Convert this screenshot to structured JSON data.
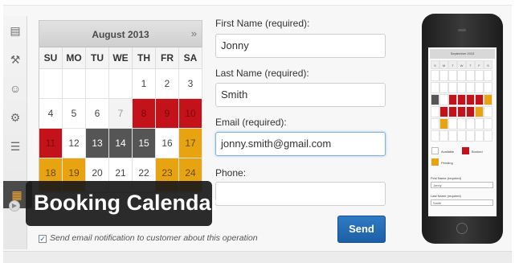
{
  "sidebar": {
    "icons": [
      {
        "name": "page-icon",
        "glyph": "▤"
      },
      {
        "name": "plugin-icon",
        "glyph": "⚒"
      },
      {
        "name": "users-icon",
        "glyph": "☺"
      },
      {
        "name": "tools-icon",
        "glyph": "⚙"
      },
      {
        "name": "settings-icon",
        "glyph": "☰"
      }
    ],
    "active_icon": {
      "name": "calendar-icon",
      "glyph": "▦"
    },
    "collapse_icon": {
      "name": "collapse-icon",
      "glyph": "▶"
    }
  },
  "calendar": {
    "month_title": "August 2013",
    "next_label": "»",
    "weekdays": [
      "SU",
      "MO",
      "TU",
      "WE",
      "TH",
      "FR",
      "SA"
    ],
    "weeks": [
      [
        {
          "d": "",
          "s": ""
        },
        {
          "d": "",
          "s": ""
        },
        {
          "d": "",
          "s": ""
        },
        {
          "d": "",
          "s": ""
        },
        {
          "d": "1",
          "s": ""
        },
        {
          "d": "2",
          "s": ""
        },
        {
          "d": "3",
          "s": ""
        }
      ],
      [
        {
          "d": "4",
          "s": ""
        },
        {
          "d": "5",
          "s": ""
        },
        {
          "d": "6",
          "s": ""
        },
        {
          "d": "7",
          "s": "past"
        },
        {
          "d": "8",
          "s": "red"
        },
        {
          "d": "9",
          "s": "red"
        },
        {
          "d": "10",
          "s": "red"
        }
      ],
      [
        {
          "d": "11",
          "s": "red"
        },
        {
          "d": "12",
          "s": ""
        },
        {
          "d": "13",
          "s": "dark"
        },
        {
          "d": "14",
          "s": "dark"
        },
        {
          "d": "15",
          "s": "dark"
        },
        {
          "d": "16",
          "s": ""
        },
        {
          "d": "17",
          "s": "orange"
        }
      ],
      [
        {
          "d": "18",
          "s": "orange"
        },
        {
          "d": "19",
          "s": "orange"
        },
        {
          "d": "20",
          "s": ""
        },
        {
          "d": "21",
          "s": ""
        },
        {
          "d": "22",
          "s": ""
        },
        {
          "d": "23",
          "s": "orange"
        },
        {
          "d": "24",
          "s": "orange"
        }
      ]
    ],
    "colors": {
      "booked": "#c4121b",
      "selected": "#555555",
      "pending": "#e8a310"
    }
  },
  "form": {
    "first_name_label": "First Name (required):",
    "first_name_value": "Jonny",
    "last_name_label": "Last Name (required):",
    "last_name_value": "Smith",
    "email_label": "Email (required):",
    "email_value": "jonny.smith@gmail.com",
    "phone_label": "Phone:",
    "phone_value": "",
    "send_label": "Send",
    "notify_label": "Send email notification to customer about this operation",
    "notify_checked": "✓"
  },
  "banner": {
    "title": "Booking Calendar"
  },
  "phone": {
    "month_title": "September 2013",
    "weekdays": [
      "S",
      "M",
      "T",
      "W",
      "T",
      "F",
      "S"
    ],
    "legend_available": "Available",
    "legend_booked": "Booked",
    "legend_pending": "Pending",
    "first_name_label": "First Name (required)",
    "first_name_value": "Jonny",
    "last_name_label": "Last Name (required)",
    "last_name_value": "Smith"
  }
}
